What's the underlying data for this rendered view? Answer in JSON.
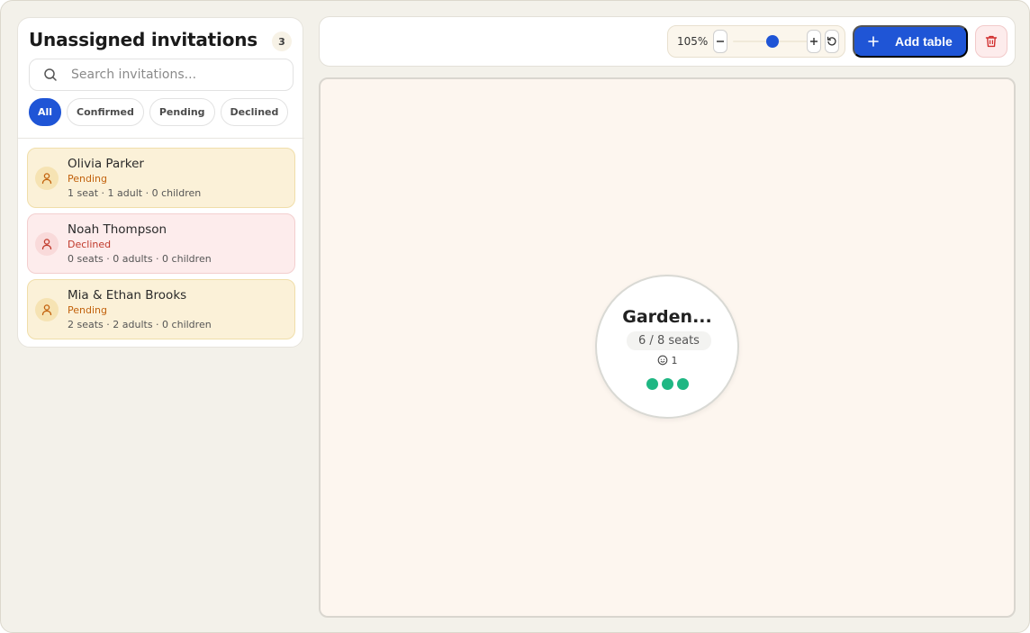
{
  "sidebar": {
    "title": "Unassigned invitations",
    "count": "3",
    "search": {
      "placeholder": "Search invitations..."
    },
    "filters": [
      {
        "label": "All",
        "active": true
      },
      {
        "label": "Confirmed",
        "active": false
      },
      {
        "label": "Pending",
        "active": false
      },
      {
        "label": "Declined",
        "active": false
      }
    ],
    "invitations": [
      {
        "name": "Olivia Parker",
        "status": "Pending",
        "meta": "1 seat · 1 adult · 0 children"
      },
      {
        "name": "Noah Thompson",
        "status": "Declined",
        "meta": "0 seats · 0 adults · 0 children"
      },
      {
        "name": "Mia & Ethan Brooks",
        "status": "Pending",
        "meta": "2 seats · 2 adults · 0 children"
      }
    ]
  },
  "toolbar": {
    "zoom_label": "105%",
    "zoom_fraction": 0.5,
    "add_table_label": "Add table",
    "icons": {
      "zoom_out": "minus-icon",
      "zoom_in": "plus-icon",
      "reset": "rotate-ccw-icon",
      "add": "plus-icon",
      "delete": "trash-icon"
    }
  },
  "canvas": {
    "table": {
      "name": "Garden...",
      "seats_label": "6 / 8 seats",
      "children_count": "1",
      "occupied_dots": 3
    }
  },
  "colors": {
    "accent": "#1f55d6",
    "pending": "#c2620d",
    "declined": "#c0392b",
    "seat_dot": "#1fb783"
  }
}
